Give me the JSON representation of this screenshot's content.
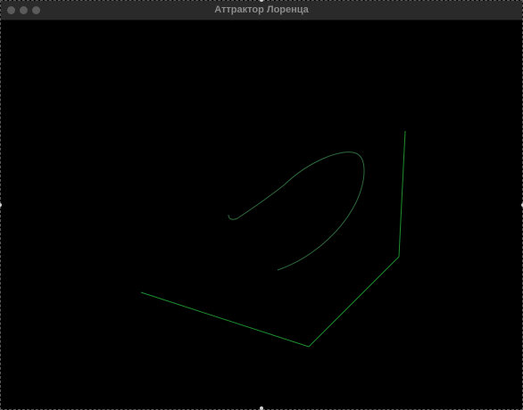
{
  "window": {
    "title": "Аттрактор Лоренца"
  },
  "colors": {
    "background": "#000000",
    "titlebar": "#2a2a2a",
    "title_text": "#8a8a8a",
    "axis": "#1f8f2f",
    "trajectory": "#2e6a3c",
    "traffic_light": "#5b5b5b"
  }
}
